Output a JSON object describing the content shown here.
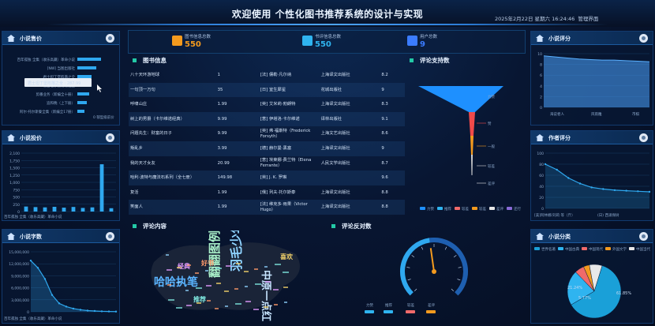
{
  "header": {
    "title": "欢迎使用 个性化图书推荐系统的设计与实现",
    "datetime": "2025年2月22日 星期六 16:24:46",
    "admin_link": "管理界面"
  },
  "stats": [
    {
      "label": "图书信息总数",
      "value": "550",
      "color": "#f39a1e"
    },
    {
      "label": "书评信息总数",
      "value": "550",
      "color": "#2fb4f0"
    },
    {
      "label": "用户总数",
      "value": "9",
      "color": "#3b7cff"
    }
  ],
  "panels": {
    "sales": "小说售价",
    "price": "小说投价",
    "words": "小说字数",
    "rating": "小说评分",
    "author": "作者评分",
    "category": "小说分类",
    "books": "图书信息",
    "support": "评论支持数",
    "content": "评论内容",
    "oppose": "评论反对数"
  },
  "sales_bars": {
    "labels": [
      "百年孤独 全集（收乐高藏）革命小说",
      "[NW] 当图出版社",
      "君士坦丁堡陷落之全",
      "君士坦丁堡陷落之全",
      "剪番业务（新编全十册）",
      "追和晚（上下册）",
      "阿尔·托尔斯秦全集（新编全17册）"
    ],
    "values": [
      10,
      8,
      6,
      6,
      5,
      4,
      3
    ],
    "tooltip": "君士坦丁堡陷落之全 : 287.99",
    "axis_label": "0 郁型级前价"
  },
  "price_chart": {
    "ticks": [
      "2,100",
      "1,750",
      "1,500",
      "1,250",
      "1,000",
      "750",
      "500",
      "250",
      "0"
    ],
    "values": [
      180,
      160,
      150,
      170,
      140,
      165,
      130,
      150,
      1700,
      120
    ],
    "xlabel": "百年孤独 全集（收乐高藏）革命小说"
  },
  "words_chart": {
    "ticks": [
      "15,000,000",
      "12,000,000",
      "9,000,000",
      "6,000,000",
      "3,000,000",
      "0"
    ],
    "values": [
      12800000,
      11000000,
      8200000,
      4200000,
      2100000,
      1300000,
      800000,
      500000,
      300000,
      200000,
      120000,
      80000,
      50000
    ],
    "xlabel": "百年孤独 全集（收乐高藏）革命小说"
  },
  "rating_chart": {
    "ticks": [
      "10",
      "8",
      "6",
      "4",
      "2",
      "0"
    ],
    "values": [
      9.6,
      9.4,
      9.2,
      9.0,
      8.9,
      8.8,
      8.8,
      8.7,
      8.6,
      8.5
    ],
    "xlabels": [
      "海说者人",
      "风雨雕",
      "市棋"
    ]
  },
  "author_chart": {
    "ticks": [
      "100",
      "80",
      "60",
      "40",
      "20",
      "0"
    ],
    "values": [
      80,
      70,
      55,
      45,
      38,
      35,
      33,
      32,
      31,
      30
    ],
    "xlabels": [
      "[美]阿林娜/刘莉 等（斤）",
      "(日) 西涌保树"
    ]
  },
  "books": [
    [
      "八十天环游地球",
      "1",
      "[法] 儒勒·凡尔纳",
      "上海译文出版社",
      "8.2"
    ],
    [
      "一句顶一万句",
      "35",
      "[日] 室生犀星",
      "花城出版社",
      "9"
    ],
    [
      "呼啸山庄",
      "1.99",
      "[英] 艾米莉·勃朗特",
      "上海译文出版社",
      "8.3"
    ],
    [
      "树上的男爵（卡尔维诺经典）",
      "9.99",
      "[意] 伊塔洛·卡尔维诺",
      "译林出版社",
      "9.1"
    ],
    [
      "问题先生：财富的日子",
      "9.99",
      "[英] 弗·福斯特（Frederick Forsyth）",
      "上海文艺出版社",
      "8.6"
    ],
    [
      "叛乱乡",
      "3.99",
      "[德] 赫尔曼·黑塞",
      "上海译文出版社",
      "9"
    ],
    [
      "我的天才女友",
      "20.99",
      "[意] 埃莱娜·费兰特（Elena Ferrante）",
      "人民文学出版社",
      "8.7"
    ],
    [
      "哈利·波特与魔法石系列（全七册）",
      "149.98",
      "[英] J. K. 罗琳",
      "",
      "9.6"
    ],
    [
      "复活",
      "1.99",
      "[俄] 列夫·托尔斯泰",
      "上海译文出版社",
      "8.8"
    ],
    [
      "笑面人",
      "1.99",
      "[法] 维克多·雨果（Victor Hugo）",
      "上海译文出版社",
      "8.8"
    ]
  ],
  "funnel": {
    "labels": [
      "力赞",
      "赞",
      "一般",
      "较差",
      "差评"
    ],
    "legend": [
      "力赞",
      "推荐",
      "较差",
      "较差",
      "差评",
      "还行"
    ],
    "colors": [
      "#1e90ff",
      "#f04a4a",
      "#f39a1e",
      "#d8d8d8",
      "#e8e8e8"
    ]
  },
  "wordcloud": [
    {
      "t": "羽毛少年",
      "c": "#8fd3ff"
    },
    {
      "t": "中原一点红",
      "c": "#c7e4ff"
    },
    {
      "t": "哈哈执笔",
      "c": "#5ab4ff"
    },
    {
      "t": "翻翻图例",
      "c": "#a9f0c9"
    },
    {
      "t": "好书",
      "c": "#ff9a6a"
    },
    {
      "t": "喜欢",
      "c": "#f3d36b"
    },
    {
      "t": "经典",
      "c": "#e39bff"
    },
    {
      "t": "推荐",
      "c": "#7fe8e0"
    }
  ],
  "gauge": {
    "value": 47,
    "max": 100,
    "ticks": [
      "0",
      "10",
      "20",
      "30",
      "40",
      "50",
      "60",
      "70",
      "80",
      "90",
      "100"
    ],
    "legend": [
      "力赞",
      "推荐",
      "较差",
      "差评"
    ],
    "legend_colors": [
      "#2fb4f0",
      "#2fb4f0",
      "#f06a6a",
      "#f39a1e"
    ]
  },
  "pie": {
    "legend": [
      "世界名著",
      "中国古典",
      "中国现代",
      "外国文学",
      "中国当代"
    ],
    "colors": [
      "#1aa0d8",
      "#2fb4f0",
      "#f06a6a",
      "#f39a1e",
      "#e8e8e8"
    ],
    "slices": [
      61.8,
      21.2,
      5.7,
      3.6,
      7.7
    ],
    "labels": [
      "61.85%",
      "21.24%",
      "5.77%"
    ]
  }
}
